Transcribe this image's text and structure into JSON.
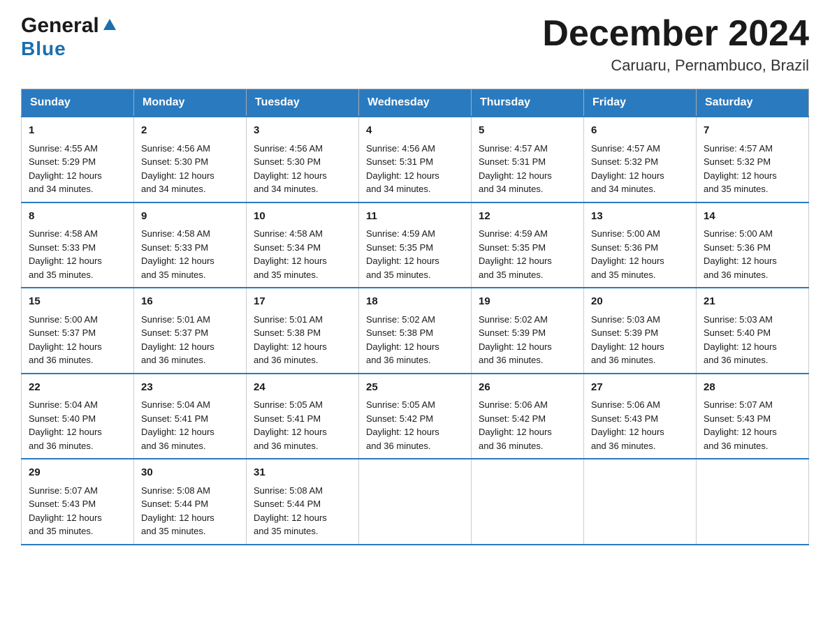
{
  "logo": {
    "line1": "General",
    "line2": "Blue"
  },
  "title": "December 2024",
  "subtitle": "Caruaru, Pernambuco, Brazil",
  "days_header": [
    "Sunday",
    "Monday",
    "Tuesday",
    "Wednesday",
    "Thursday",
    "Friday",
    "Saturday"
  ],
  "weeks": [
    [
      {
        "num": "1",
        "info": "Sunrise: 4:55 AM\nSunset: 5:29 PM\nDaylight: 12 hours\nand 34 minutes."
      },
      {
        "num": "2",
        "info": "Sunrise: 4:56 AM\nSunset: 5:30 PM\nDaylight: 12 hours\nand 34 minutes."
      },
      {
        "num": "3",
        "info": "Sunrise: 4:56 AM\nSunset: 5:30 PM\nDaylight: 12 hours\nand 34 minutes."
      },
      {
        "num": "4",
        "info": "Sunrise: 4:56 AM\nSunset: 5:31 PM\nDaylight: 12 hours\nand 34 minutes."
      },
      {
        "num": "5",
        "info": "Sunrise: 4:57 AM\nSunset: 5:31 PM\nDaylight: 12 hours\nand 34 minutes."
      },
      {
        "num": "6",
        "info": "Sunrise: 4:57 AM\nSunset: 5:32 PM\nDaylight: 12 hours\nand 34 minutes."
      },
      {
        "num": "7",
        "info": "Sunrise: 4:57 AM\nSunset: 5:32 PM\nDaylight: 12 hours\nand 35 minutes."
      }
    ],
    [
      {
        "num": "8",
        "info": "Sunrise: 4:58 AM\nSunset: 5:33 PM\nDaylight: 12 hours\nand 35 minutes."
      },
      {
        "num": "9",
        "info": "Sunrise: 4:58 AM\nSunset: 5:33 PM\nDaylight: 12 hours\nand 35 minutes."
      },
      {
        "num": "10",
        "info": "Sunrise: 4:58 AM\nSunset: 5:34 PM\nDaylight: 12 hours\nand 35 minutes."
      },
      {
        "num": "11",
        "info": "Sunrise: 4:59 AM\nSunset: 5:35 PM\nDaylight: 12 hours\nand 35 minutes."
      },
      {
        "num": "12",
        "info": "Sunrise: 4:59 AM\nSunset: 5:35 PM\nDaylight: 12 hours\nand 35 minutes."
      },
      {
        "num": "13",
        "info": "Sunrise: 5:00 AM\nSunset: 5:36 PM\nDaylight: 12 hours\nand 35 minutes."
      },
      {
        "num": "14",
        "info": "Sunrise: 5:00 AM\nSunset: 5:36 PM\nDaylight: 12 hours\nand 36 minutes."
      }
    ],
    [
      {
        "num": "15",
        "info": "Sunrise: 5:00 AM\nSunset: 5:37 PM\nDaylight: 12 hours\nand 36 minutes."
      },
      {
        "num": "16",
        "info": "Sunrise: 5:01 AM\nSunset: 5:37 PM\nDaylight: 12 hours\nand 36 minutes."
      },
      {
        "num": "17",
        "info": "Sunrise: 5:01 AM\nSunset: 5:38 PM\nDaylight: 12 hours\nand 36 minutes."
      },
      {
        "num": "18",
        "info": "Sunrise: 5:02 AM\nSunset: 5:38 PM\nDaylight: 12 hours\nand 36 minutes."
      },
      {
        "num": "19",
        "info": "Sunrise: 5:02 AM\nSunset: 5:39 PM\nDaylight: 12 hours\nand 36 minutes."
      },
      {
        "num": "20",
        "info": "Sunrise: 5:03 AM\nSunset: 5:39 PM\nDaylight: 12 hours\nand 36 minutes."
      },
      {
        "num": "21",
        "info": "Sunrise: 5:03 AM\nSunset: 5:40 PM\nDaylight: 12 hours\nand 36 minutes."
      }
    ],
    [
      {
        "num": "22",
        "info": "Sunrise: 5:04 AM\nSunset: 5:40 PM\nDaylight: 12 hours\nand 36 minutes."
      },
      {
        "num": "23",
        "info": "Sunrise: 5:04 AM\nSunset: 5:41 PM\nDaylight: 12 hours\nand 36 minutes."
      },
      {
        "num": "24",
        "info": "Sunrise: 5:05 AM\nSunset: 5:41 PM\nDaylight: 12 hours\nand 36 minutes."
      },
      {
        "num": "25",
        "info": "Sunrise: 5:05 AM\nSunset: 5:42 PM\nDaylight: 12 hours\nand 36 minutes."
      },
      {
        "num": "26",
        "info": "Sunrise: 5:06 AM\nSunset: 5:42 PM\nDaylight: 12 hours\nand 36 minutes."
      },
      {
        "num": "27",
        "info": "Sunrise: 5:06 AM\nSunset: 5:43 PM\nDaylight: 12 hours\nand 36 minutes."
      },
      {
        "num": "28",
        "info": "Sunrise: 5:07 AM\nSunset: 5:43 PM\nDaylight: 12 hours\nand 36 minutes."
      }
    ],
    [
      {
        "num": "29",
        "info": "Sunrise: 5:07 AM\nSunset: 5:43 PM\nDaylight: 12 hours\nand 35 minutes."
      },
      {
        "num": "30",
        "info": "Sunrise: 5:08 AM\nSunset: 5:44 PM\nDaylight: 12 hours\nand 35 minutes."
      },
      {
        "num": "31",
        "info": "Sunrise: 5:08 AM\nSunset: 5:44 PM\nDaylight: 12 hours\nand 35 minutes."
      },
      {
        "num": "",
        "info": ""
      },
      {
        "num": "",
        "info": ""
      },
      {
        "num": "",
        "info": ""
      },
      {
        "num": "",
        "info": ""
      }
    ]
  ]
}
